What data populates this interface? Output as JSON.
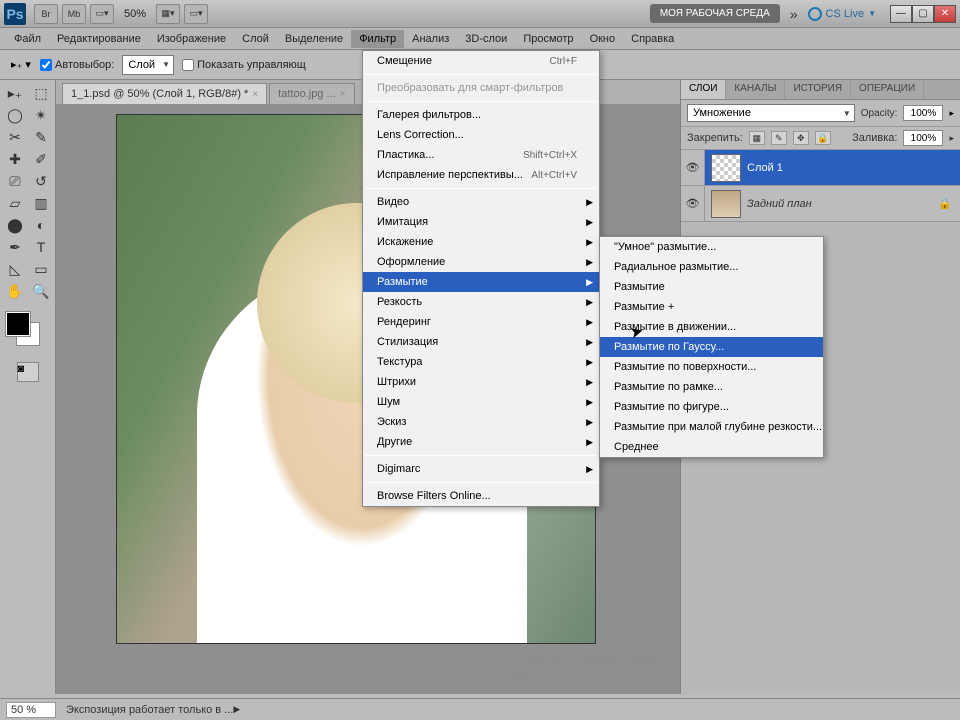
{
  "titlebar": {
    "zoom": "50%",
    "workspace": "МОЯ РАБОЧАЯ СРЕДА",
    "cslive": "CS Live"
  },
  "menubar": {
    "items": [
      "Файл",
      "Редактирование",
      "Изображение",
      "Слой",
      "Выделение",
      "Фильтр",
      "Анализ",
      "3D-слои",
      "Просмотр",
      "Окно",
      "Справка"
    ],
    "active_index": 5
  },
  "optionsbar": {
    "autoselect_label": "Автовыбор:",
    "autoselect_value": "Слой",
    "show_controls_label": "Показать управляющ"
  },
  "tabs": [
    {
      "label": "1_1.psd @ 50% (Слой 1, RGB/8#) *",
      "active": true
    },
    {
      "label": "tattoo.jpg ...",
      "active": false
    }
  ],
  "tools": [
    "▭",
    "⬚",
    "◯",
    "⇗",
    "⊹",
    "✂",
    "✎",
    "✐",
    "⟋",
    "△",
    "⎚",
    "⎔",
    "◧",
    "⊕",
    "◐",
    "✥",
    "▤",
    "T",
    "◺",
    "⬠",
    "✋",
    "🔍"
  ],
  "filter_menu": {
    "recent": {
      "label": "Смещение",
      "shortcut": "Ctrl+F"
    },
    "convert": "Преобразовать для смарт-фильтров",
    "items_top": [
      {
        "label": "Галерея фильтров...",
        "shortcut": ""
      },
      {
        "label": "Lens Correction...",
        "shortcut": ""
      },
      {
        "label": "Пластика...",
        "shortcut": "Shift+Ctrl+X"
      },
      {
        "label": "Исправление перспективы...",
        "shortcut": "Alt+Ctrl+V"
      }
    ],
    "categories": [
      "Видео",
      "Имитация",
      "Искажение",
      "Оформление",
      "Размытие",
      "Резкость",
      "Рендеринг",
      "Стилизация",
      "Текстура",
      "Штрихи",
      "Шум",
      "Эскиз",
      "Другие"
    ],
    "highlighted_index": 4,
    "digimarc": "Digimarc",
    "browse": "Browse Filters Online..."
  },
  "blur_submenu": {
    "items": [
      "\"Умное\" размытие...",
      "Радиальное размытие...",
      "Размытие",
      "Размытие +",
      "Размытие в движении...",
      "Размытие по Гауссу...",
      "Размытие по поверхности...",
      "Размытие по рамке...",
      "Размытие по фигуре...",
      "Размытие при малой глубине резкости...",
      "Среднее"
    ],
    "highlighted_index": 5
  },
  "panels": {
    "tabs": [
      "СЛОИ",
      "КАНАЛЫ",
      "ИСТОРИЯ",
      "ОПЕРАЦИИ"
    ],
    "active_tab": 0,
    "blend_mode": "Умножение",
    "opacity_label": "Opacity:",
    "opacity_value": "100%",
    "lock_label": "Закрепить:",
    "fill_label": "Заливка:",
    "fill_value": "100%",
    "layers": [
      {
        "name": "Слой 1",
        "selected": true,
        "bg": false,
        "locked": false
      },
      {
        "name": "Задний план",
        "selected": false,
        "bg": true,
        "locked": true
      }
    ]
  },
  "statusbar": {
    "zoom": "50 %",
    "msg": "Экспозиция работает только в ..."
  },
  "credit": {
    "author": "АВТОР: ГУЛЕВИЧ ПАВЕЛ",
    "site": "WWW.PHOTOSHOP-PHP.RU"
  }
}
